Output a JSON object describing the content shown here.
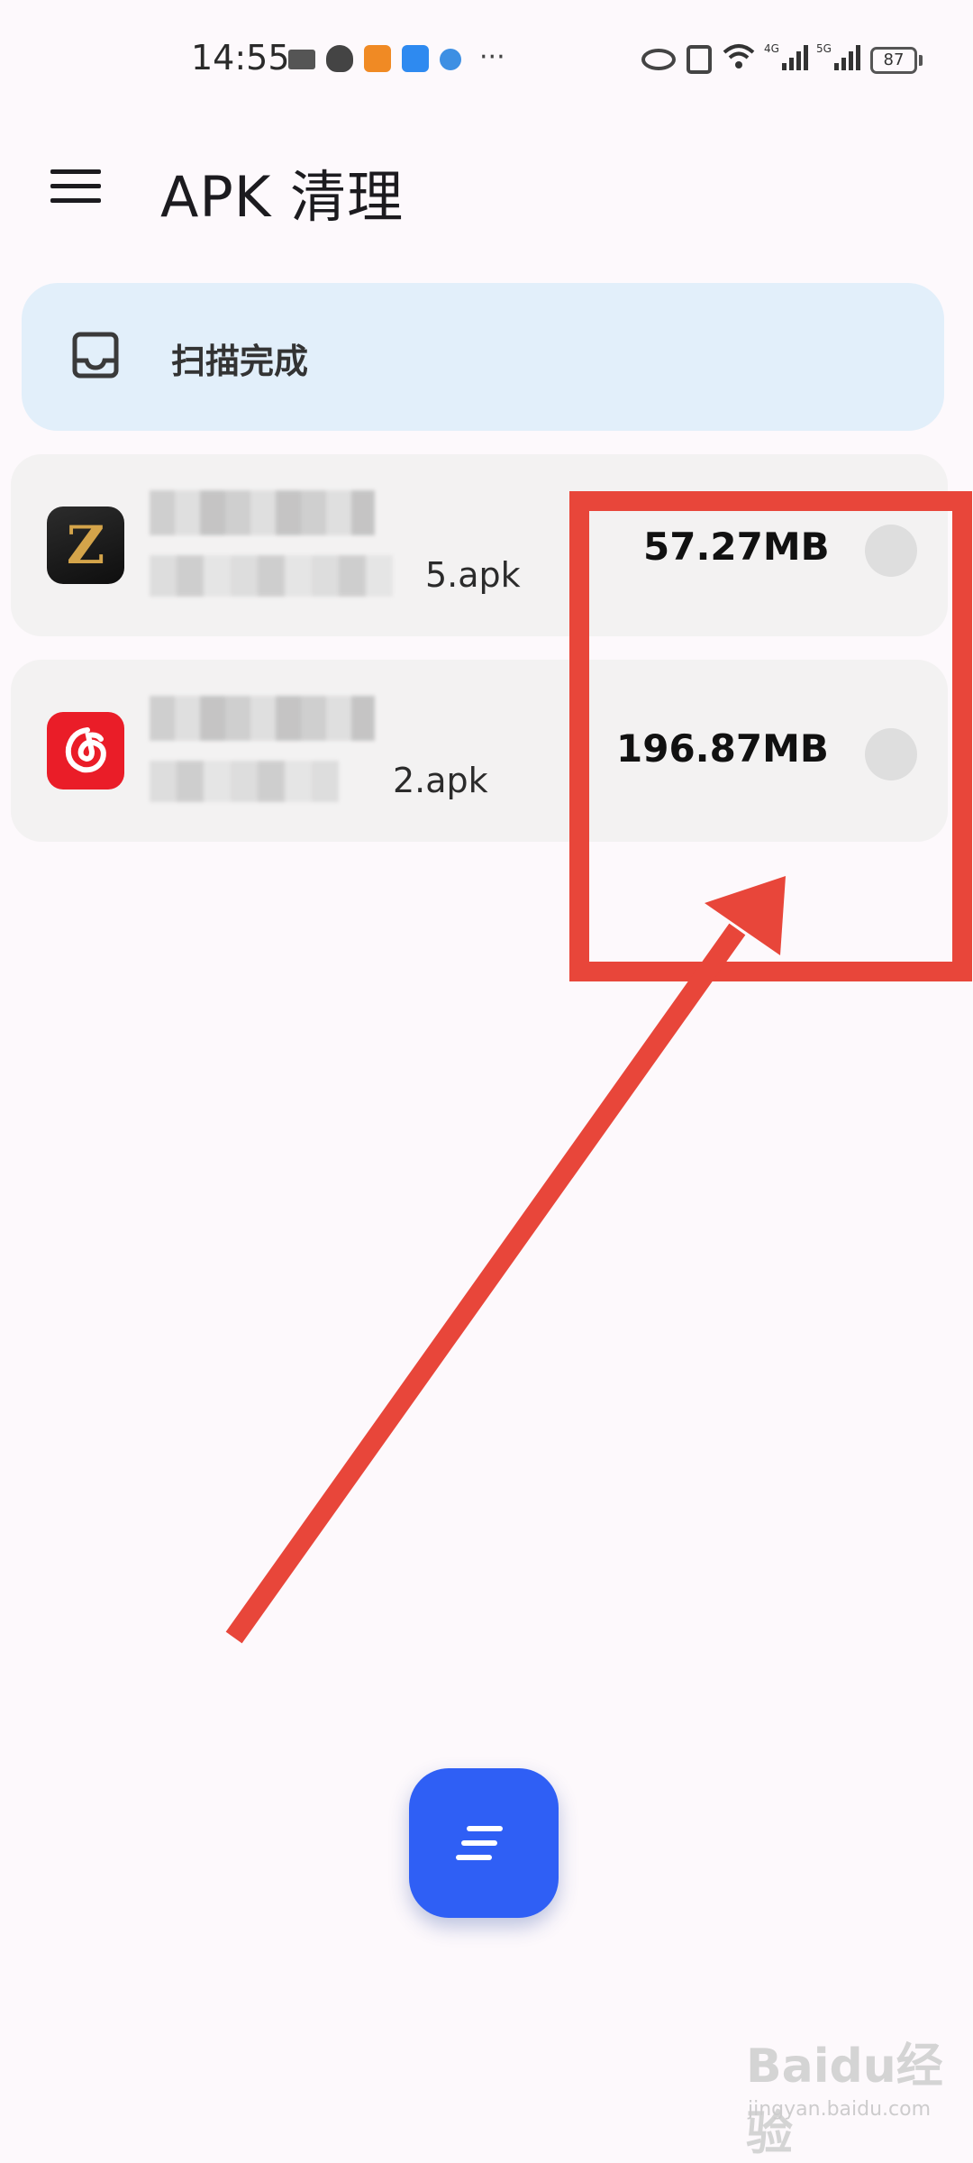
{
  "status_bar": {
    "time": "14:55",
    "more": "···",
    "network_1": "4G",
    "network_2": "5G",
    "battery": "87"
  },
  "app_bar": {
    "title": "APK 清理"
  },
  "scan": {
    "status_label": "扫描完成"
  },
  "apk_list": [
    {
      "file_suffix": "5.apk",
      "size": "57.27MB",
      "icon": "zelda-style-z-icon"
    },
    {
      "file_suffix": "2.apk",
      "size": "196.87MB",
      "icon": "netease-music-icon"
    }
  ],
  "watermark": {
    "main": "Baidu经验",
    "sub": "jingyan.baidu.com"
  },
  "colors": {
    "background": "#fdf9fc",
    "scan_card": "#e2effa",
    "list_item": "#f3f2f2",
    "fab": "#2f5ff5",
    "annotation": "#e8463a"
  }
}
